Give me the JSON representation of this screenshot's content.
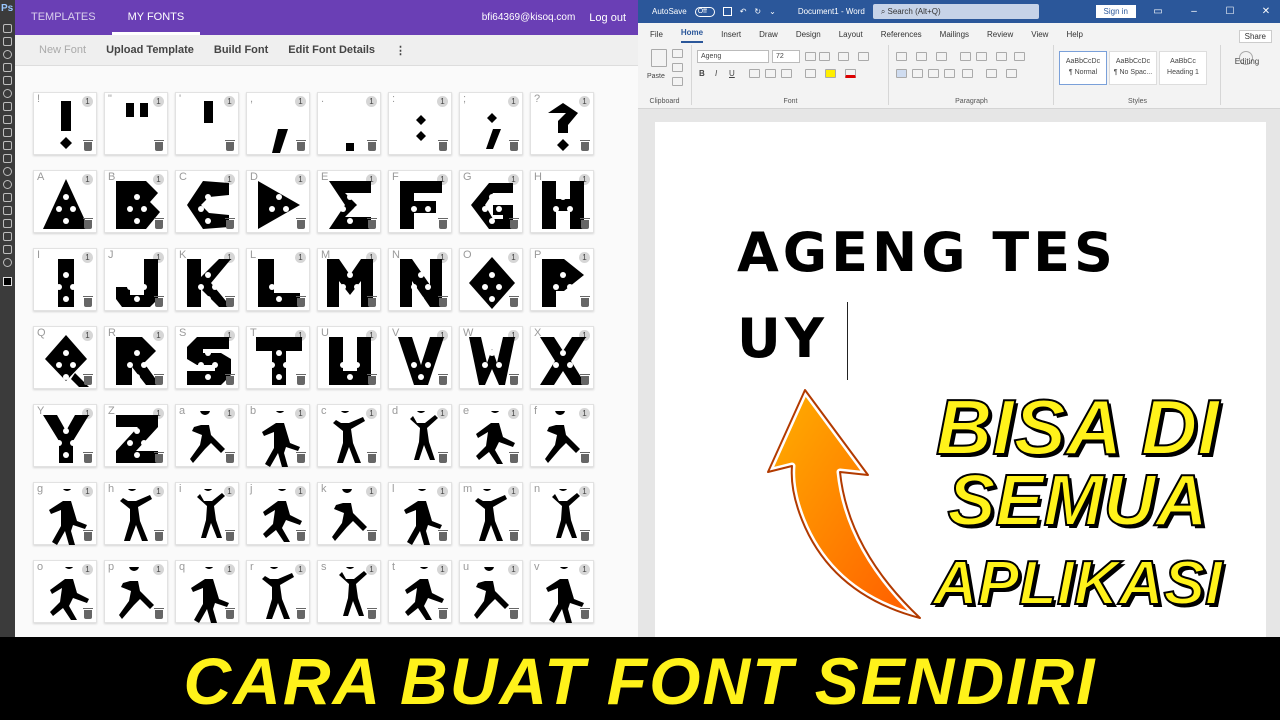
{
  "photoshop": {
    "logo": "Ps"
  },
  "calligraphr": {
    "tabs": [
      "TEMPLATES",
      "MY FONTS"
    ],
    "user": "bfi64369@kisoq.com",
    "logout": "Log out",
    "toolbar": [
      "New Font",
      "Upload Template",
      "Build Font",
      "Edit Font Details"
    ],
    "menu": "⋮",
    "count": "1",
    "rows": [
      [
        [
          "!",
          "glyph-exclaim"
        ],
        [
          "\"",
          "glyph-quote"
        ],
        [
          "'",
          "glyph-apos"
        ],
        [
          ",",
          "glyph-comma"
        ],
        [
          ".",
          "glyph-period"
        ],
        [
          ":",
          "glyph-colon"
        ],
        [
          ";",
          "glyph-semicolon"
        ],
        [
          "?",
          "glyph-question"
        ]
      ],
      [
        [
          "A",
          "glyph-A"
        ],
        [
          "B",
          "glyph-B"
        ],
        [
          "C",
          "glyph-C"
        ],
        [
          "D",
          "glyph-D"
        ],
        [
          "E",
          "glyph-E"
        ],
        [
          "F",
          "glyph-F"
        ],
        [
          "G",
          "glyph-G"
        ],
        [
          "H",
          "glyph-H"
        ]
      ],
      [
        [
          "I",
          "glyph-I"
        ],
        [
          "J",
          "glyph-J"
        ],
        [
          "K",
          "glyph-K"
        ],
        [
          "L",
          "glyph-L"
        ],
        [
          "M",
          "glyph-M"
        ],
        [
          "N",
          "glyph-N"
        ],
        [
          "O",
          "glyph-O"
        ],
        [
          "P",
          "glyph-P"
        ]
      ],
      [
        [
          "Q",
          "glyph-Q"
        ],
        [
          "R",
          "glyph-R"
        ],
        [
          "S",
          "glyph-S"
        ],
        [
          "T",
          "glyph-T"
        ],
        [
          "U",
          "glyph-U"
        ],
        [
          "V",
          "glyph-V"
        ],
        [
          "W",
          "glyph-W"
        ],
        [
          "X",
          "glyph-X"
        ]
      ],
      [
        [
          "Y",
          "glyph-Y"
        ],
        [
          "Z",
          "glyph-Z"
        ],
        [
          "a",
          "dancer-icon"
        ],
        [
          "b",
          "dancer-icon"
        ],
        [
          "c",
          "dancer-icon"
        ],
        [
          "d",
          "dancer-icon"
        ],
        [
          "e",
          "dancer-icon"
        ],
        [
          "f",
          "dancer-icon"
        ]
      ],
      [
        [
          "g",
          "dancer-icon"
        ],
        [
          "h",
          "dancer-icon"
        ],
        [
          "i",
          "dancer-icon"
        ],
        [
          "j",
          "dancer-icon"
        ],
        [
          "k",
          "dancer-icon"
        ],
        [
          "l",
          "dancer-icon"
        ],
        [
          "m",
          "dancer-icon"
        ],
        [
          "n",
          "dancer-icon"
        ]
      ],
      [
        [
          "o",
          "dancer-icon"
        ],
        [
          "p",
          "dancer-icon"
        ],
        [
          "q",
          "dancer-icon"
        ],
        [
          "r",
          "dancer-icon"
        ],
        [
          "s",
          "dancer-icon"
        ],
        [
          "t",
          "dancer-icon"
        ],
        [
          "u",
          "dancer-icon"
        ],
        [
          "v",
          "dancer-icon"
        ]
      ]
    ]
  },
  "word": {
    "autosave": "AutoSave",
    "toggle": "Off",
    "title": "Document1 - Word",
    "search": "Search (Alt+Q)",
    "signin": "Sign in",
    "tabs": [
      "File",
      "Home",
      "Insert",
      "Draw",
      "Design",
      "Layout",
      "References",
      "Mailings",
      "Review",
      "View",
      "Help"
    ],
    "share": "Share",
    "paste": "Paste",
    "font_name": "Ageng",
    "font_size": "72",
    "groups": {
      "clipboard": "Clipboard",
      "font": "Font",
      "paragraph": "Paragraph",
      "styles": "Styles"
    },
    "styles": [
      {
        "sample": "AaBbCcDc",
        "name": "¶ Normal"
      },
      {
        "sample": "AaBbCcDc",
        "name": "¶ No Spac..."
      },
      {
        "sample": "AaBbCc",
        "name": "Heading 1"
      }
    ],
    "editing": "Editing",
    "document_text": "AGENG TES\nUY"
  },
  "overlay": {
    "line1": "BISA DI",
    "line2": "SEMUA",
    "line3": "APLIKASI",
    "banner": "CARA BUAT FONT SENDIRI",
    "text_color": "#fff21a",
    "arrow_color": "#ff7a00"
  }
}
